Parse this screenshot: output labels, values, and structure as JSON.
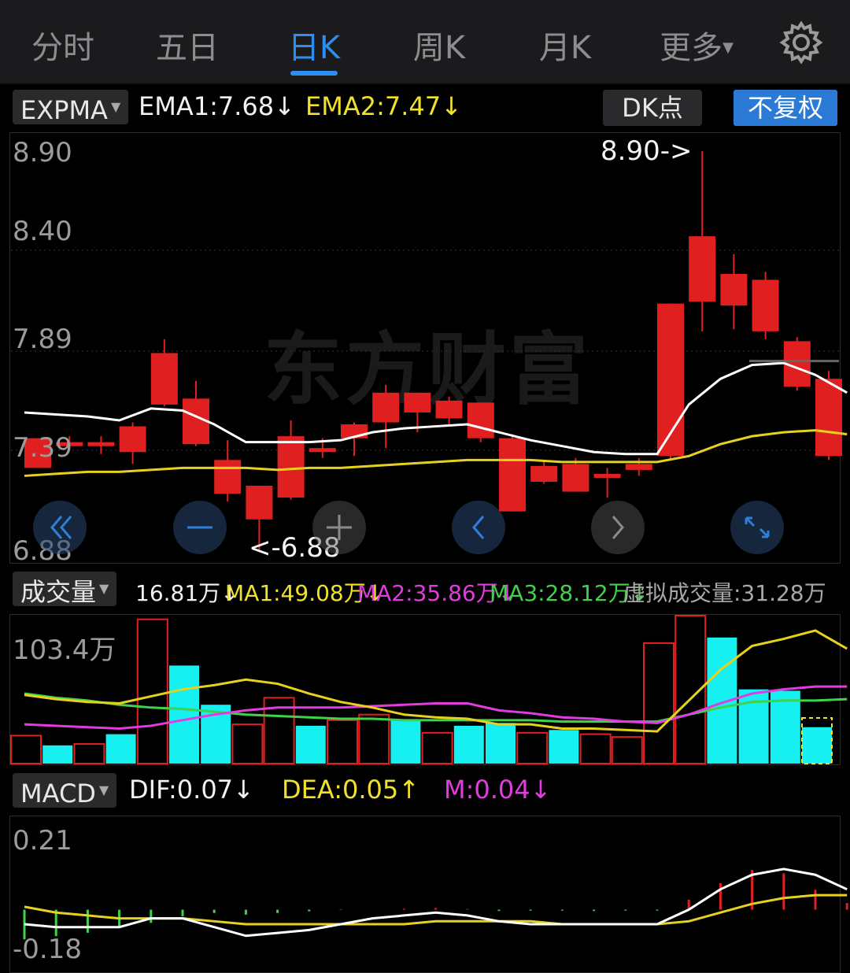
{
  "tabs": {
    "items": [
      "分时",
      "五日",
      "日K",
      "周K",
      "月K",
      "更多"
    ],
    "active": "日K",
    "settings_icon": "gear-icon"
  },
  "main_header": {
    "indicator": "EXPMA",
    "ema1": "EMA1:7.68",
    "ema1_arrow": "↓",
    "ema2": "EMA2:7.47",
    "ema2_arrow": "↓",
    "dk_label": "DK点",
    "adjust_label": "不复权"
  },
  "main_axis": {
    "ticks": [
      "8.90",
      "8.40",
      "7.89",
      "7.39",
      "6.88"
    ],
    "high_marker": "8.90->",
    "low_marker": "<-6.88"
  },
  "watermark": "东方财富",
  "volume_header": {
    "indicator": "成交量",
    "vol": "16.81万",
    "vol_arrow": "↓",
    "ma1": "MA1:49.08万",
    "ma1_arrow": "↓",
    "ma2": "MA2:35.86万",
    "ma2_arrow": "↓",
    "ma3": "MA3:28.12万",
    "ma3_arrow": "↓",
    "virtual": "虚拟成交量:31.28万"
  },
  "volume_axis": {
    "top": "103.4万"
  },
  "macd_header": {
    "indicator": "MACD",
    "dif": "DIF:0.07",
    "dif_arrow": "↓",
    "dea": "DEA:0.05",
    "dea_arrow": "↑",
    "m": "M:0.04",
    "m_arrow": "↓"
  },
  "macd_axis": {
    "top": "0.21",
    "bottom": "-0.18"
  },
  "colors": {
    "up": "#e02020",
    "down": "#16f0f0",
    "ema1": "#ffffff",
    "ema2": "#e6d21e",
    "ma3": "#3ed34a",
    "ma2": "#e23be0",
    "accent": "#2b8ef0"
  },
  "chart_data": {
    "type": "candlestick",
    "price_ylim": [
      6.88,
      8.9
    ],
    "price_ticks": [
      8.9,
      8.4,
      7.89,
      7.39,
      6.88
    ],
    "candles": [
      {
        "o": 7.3,
        "c": 7.45,
        "h": 7.45,
        "l": 7.3
      },
      {
        "o": 7.41,
        "c": 7.43,
        "h": 7.46,
        "l": 7.39
      },
      {
        "o": 7.41,
        "c": 7.43,
        "h": 7.46,
        "l": 7.37
      },
      {
        "o": 7.38,
        "c": 7.51,
        "h": 7.53,
        "l": 7.32
      },
      {
        "o": 7.62,
        "c": 7.88,
        "h": 7.95,
        "l": 7.61
      },
      {
        "o": 7.42,
        "c": 7.65,
        "h": 7.74,
        "l": 7.41
      },
      {
        "o": 7.17,
        "c": 7.34,
        "h": 7.44,
        "l": 7.13
      },
      {
        "o": 7.04,
        "c": 7.21,
        "h": 7.21,
        "l": 6.88
      },
      {
        "o": 7.15,
        "c": 7.46,
        "h": 7.54,
        "l": 7.14
      },
      {
        "o": 7.38,
        "c": 7.4,
        "h": 7.45,
        "l": 7.35
      },
      {
        "o": 7.45,
        "c": 7.52,
        "h": 7.53,
        "l": 7.36
      },
      {
        "o": 7.53,
        "c": 7.68,
        "h": 7.72,
        "l": 7.4
      },
      {
        "o": 7.58,
        "c": 7.68,
        "h": 7.68,
        "l": 7.48
      },
      {
        "o": 7.55,
        "c": 7.64,
        "h": 7.66,
        "l": 7.52
      },
      {
        "o": 7.45,
        "c": 7.63,
        "h": 7.63,
        "l": 7.43
      },
      {
        "o": 7.08,
        "c": 7.45,
        "h": 7.47,
        "l": 7.08
      },
      {
        "o": 7.23,
        "c": 7.31,
        "h": 7.34,
        "l": 7.22
      },
      {
        "o": 7.18,
        "c": 7.32,
        "h": 7.35,
        "l": 7.18
      },
      {
        "o": 7.25,
        "c": 7.27,
        "h": 7.3,
        "l": 7.15
      },
      {
        "o": 7.29,
        "c": 7.32,
        "h": 7.35,
        "l": 7.26
      },
      {
        "o": 7.36,
        "c": 8.13,
        "h": 8.13,
        "l": 7.34
      },
      {
        "o": 8.14,
        "c": 8.47,
        "h": 8.9,
        "l": 7.99
      },
      {
        "o": 8.12,
        "c": 8.28,
        "h": 8.38,
        "l": 8.0
      },
      {
        "o": 7.99,
        "c": 8.25,
        "h": 8.29,
        "l": 7.95
      },
      {
        "o": 7.71,
        "c": 7.94,
        "h": 7.96,
        "l": 7.69
      },
      {
        "o": 7.36,
        "c": 7.75,
        "h": 7.79,
        "l": 7.34
      }
    ],
    "ema1": [
      7.58,
      7.57,
      7.56,
      7.54,
      7.6,
      7.59,
      7.52,
      7.43,
      7.43,
      7.43,
      7.44,
      7.48,
      7.5,
      7.51,
      7.52,
      7.48,
      7.44,
      7.41,
      7.38,
      7.37,
      7.37,
      7.62,
      7.75,
      7.82,
      7.83,
      7.77,
      7.68
    ],
    "ema2": [
      7.26,
      7.27,
      7.28,
      7.28,
      7.29,
      7.3,
      7.3,
      7.3,
      7.29,
      7.3,
      7.3,
      7.31,
      7.32,
      7.33,
      7.34,
      7.34,
      7.34,
      7.33,
      7.33,
      7.33,
      7.33,
      7.36,
      7.42,
      7.46,
      7.48,
      7.49,
      7.47
    ],
    "extra_segment_price": 7.84,
    "volume": {
      "ylim": [
        0,
        103.4
      ],
      "bars": [
        {
          "v": 20,
          "up": true
        },
        {
          "v": 13,
          "up": false
        },
        {
          "v": 14,
          "up": true
        },
        {
          "v": 21,
          "up": false
        },
        {
          "v": 103,
          "up": true
        },
        {
          "v": 70,
          "up": false
        },
        {
          "v": 42,
          "up": false
        },
        {
          "v": 28,
          "up": true
        },
        {
          "v": 47,
          "up": true
        },
        {
          "v": 27,
          "up": false
        },
        {
          "v": 31,
          "up": true
        },
        {
          "v": 35,
          "up": true
        },
        {
          "v": 31,
          "up": false
        },
        {
          "v": 22,
          "up": true
        },
        {
          "v": 27,
          "up": false
        },
        {
          "v": 29,
          "up": false
        },
        {
          "v": 22,
          "up": true
        },
        {
          "v": 24,
          "up": false
        },
        {
          "v": 21,
          "up": true
        },
        {
          "v": 19,
          "up": true
        },
        {
          "v": 86,
          "up": true
        },
        {
          "v": 170,
          "up": true
        },
        {
          "v": 90,
          "up": false
        },
        {
          "v": 53,
          "up": false
        },
        {
          "v": 52,
          "up": false
        },
        {
          "v": 26,
          "up": false
        }
      ],
      "ma1": [
        49,
        46,
        44,
        43,
        48,
        53,
        56,
        60,
        57,
        50,
        44,
        40,
        35,
        33,
        32,
        28,
        28,
        25,
        25,
        24,
        23,
        45,
        67,
        84,
        89,
        95,
        82
      ],
      "ma2": [
        28,
        27,
        26,
        25,
        27,
        31,
        35,
        38,
        40,
        40,
        40,
        41,
        42,
        43,
        43,
        38,
        36,
        33,
        32,
        30,
        29,
        35,
        43,
        50,
        53,
        55,
        55
      ],
      "ma3": [
        50,
        47,
        45,
        42,
        40,
        39,
        37,
        35,
        34,
        33,
        32,
        32,
        31,
        31,
        31,
        31,
        31,
        30,
        30,
        30,
        30,
        35,
        40,
        44,
        45,
        45,
        46
      ]
    },
    "macd": {
      "ylim": [
        -0.18,
        0.21
      ],
      "hist": [
        -0.09,
        -0.08,
        -0.07,
        -0.05,
        -0.04,
        -0.02,
        -0.01,
        -0.015,
        -0.01,
        -0.005,
        -0.001,
        0.0,
        0.003,
        0.005,
        0.002,
        -0.004,
        -0.003,
        -0.003,
        -0.004,
        -0.003,
        -0.003,
        0.03,
        0.08,
        0.12,
        0.11,
        0.06,
        0.02
      ],
      "dif": [
        -0.05,
        -0.06,
        -0.06,
        -0.06,
        -0.03,
        -0.03,
        -0.06,
        -0.09,
        -0.08,
        -0.07,
        -0.05,
        -0.03,
        -0.02,
        -0.01,
        -0.02,
        -0.04,
        -0.05,
        -0.05,
        -0.05,
        -0.05,
        -0.05,
        0.0,
        0.07,
        0.12,
        0.14,
        0.12,
        0.07
      ],
      "dea": [
        0.01,
        -0.01,
        -0.02,
        -0.03,
        -0.03,
        -0.03,
        -0.04,
        -0.05,
        -0.05,
        -0.05,
        -0.05,
        -0.05,
        -0.05,
        -0.04,
        -0.04,
        -0.04,
        -0.04,
        -0.05,
        -0.05,
        -0.05,
        -0.05,
        -0.04,
        -0.01,
        0.02,
        0.04,
        0.05,
        0.05
      ]
    }
  }
}
